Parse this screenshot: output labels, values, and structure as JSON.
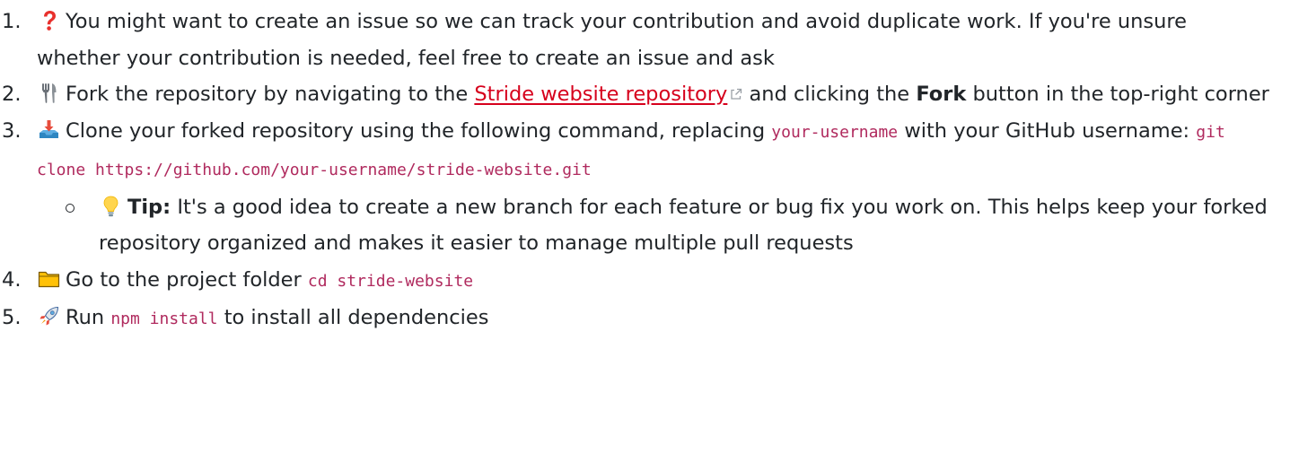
{
  "steps": [
    {
      "number": "1.",
      "icon": "question-mark-icon",
      "text": "You might want to create an issue so we can track your contribution and avoid duplicate work. If you're unsure whether your contribution is needed, feel free to create an issue and ask"
    },
    {
      "number": "2.",
      "icon": "fork-and-knife-icon",
      "text_before": "Fork the repository by navigating to the",
      "link_text": "Stride website repository",
      "text_middle": "and clicking the",
      "bold_text": "Fork",
      "text_after": "button in the top-right corner"
    },
    {
      "number": "3.",
      "icon": "inbox-tray-icon",
      "text_before": "Clone your forked repository using the following command, replacing",
      "code_placeholder": "your-username",
      "text_middle": "with your GitHub username:",
      "code_command": "git clone https://github.com/your-username/stride-website.git",
      "tip": {
        "icon": "light-bulb-icon",
        "label": "Tip:",
        "text": "It's a good idea to create a new branch for each feature or bug fix you work on. This helps keep your forked repository organized and makes it easier to manage multiple pull requests"
      }
    },
    {
      "number": "4.",
      "icon": "folder-icon",
      "text": "Go to the project folder",
      "code": "cd stride-website"
    },
    {
      "number": "5.",
      "icon": "rocket-icon",
      "text_before": "Run",
      "code": "npm install",
      "text_after": "to install all dependencies"
    }
  ],
  "colors": {
    "link": "#d6001c",
    "code": "#b02a5e",
    "text": "#212529"
  }
}
